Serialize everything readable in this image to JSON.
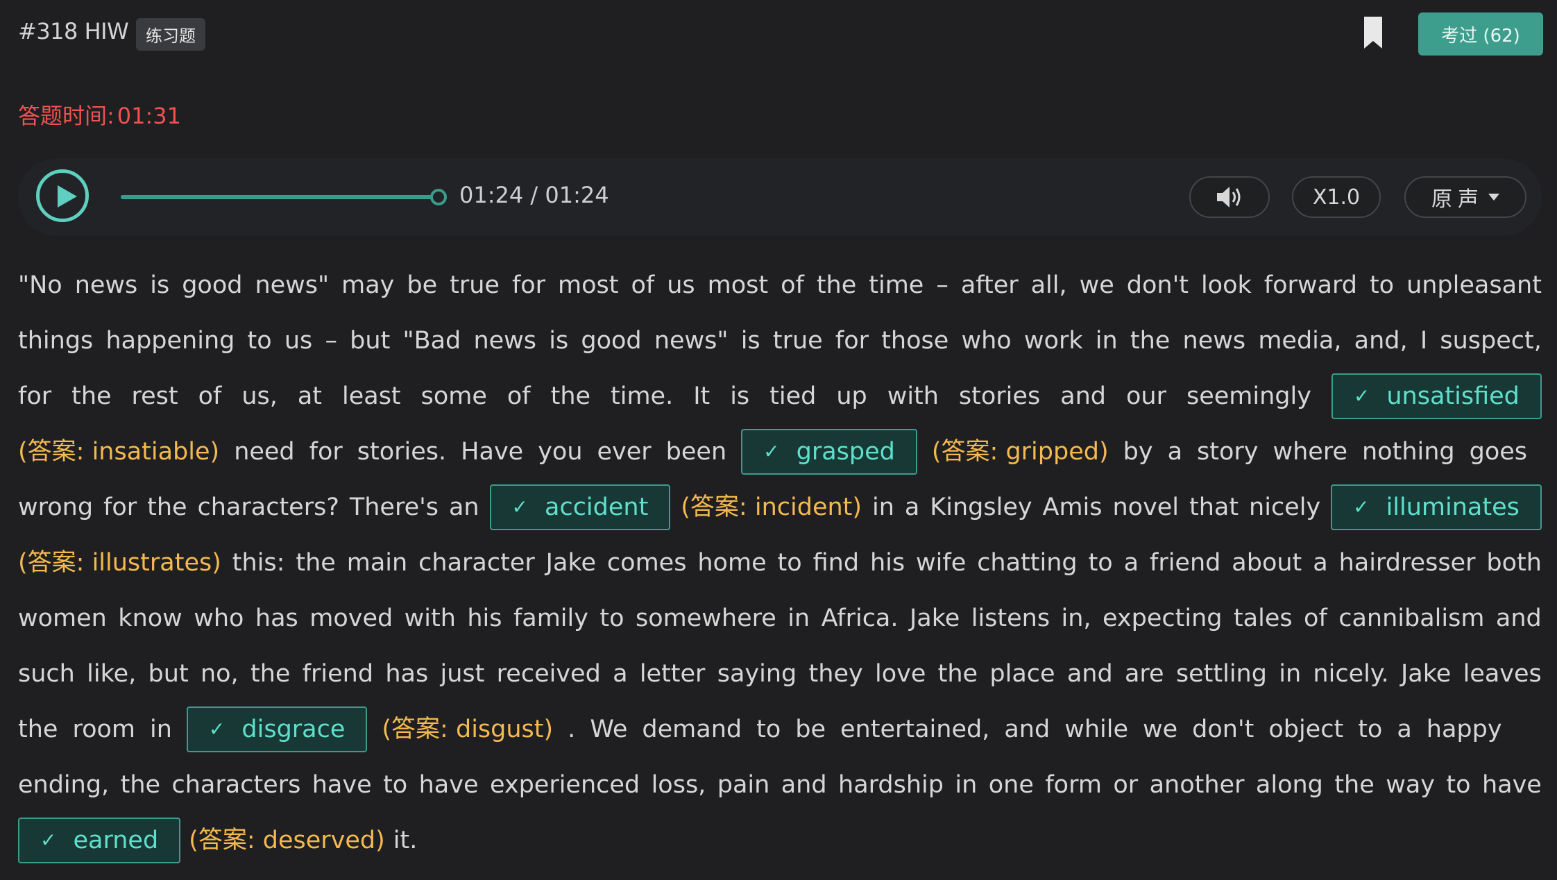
{
  "header": {
    "question_id": "#318 HIW",
    "tag": "练习题",
    "exam_button": "考过 (62)"
  },
  "timer": {
    "label": "答题时间:",
    "value": "01:31"
  },
  "player": {
    "time": "01:24 / 01:24",
    "progress": 1.0,
    "speed": "X1.0",
    "voice": "原声",
    "icons": [
      "play-icon",
      "volume-icon",
      "caret-down-icon"
    ]
  },
  "passage": {
    "line1": [
      "\"No",
      "news",
      "is",
      "good",
      "news\"",
      "may",
      "be",
      "true",
      "for",
      "most",
      "of",
      "us",
      "most",
      "of",
      "the",
      "time",
      "–",
      "after",
      "all,",
      "we",
      "don't",
      "look",
      "forward",
      "to",
      "unpleasant"
    ],
    "line2": [
      "things",
      "happening",
      "to",
      "us",
      "–",
      "but",
      "\"Bad",
      "news",
      "is",
      "good",
      "news\"",
      "is",
      "true",
      "for",
      "those",
      "who",
      "work",
      "in",
      "the",
      "news",
      "media,",
      "and,",
      "I",
      "suspect,"
    ],
    "line3": [
      "for",
      "the",
      "rest",
      "of",
      "us,",
      "at",
      "least",
      "some",
      "of",
      "the",
      "time.",
      "It",
      "is",
      "tied",
      "up",
      "with",
      "stories",
      "and",
      "our",
      "seemingly"
    ],
    "line4": [
      "need",
      "for",
      "stories.",
      "Have",
      "you",
      "ever",
      "been"
    ],
    "line4b": [
      "by",
      "a",
      "story",
      "where",
      "nothing",
      "goes"
    ],
    "line5": [
      "wrong",
      "for",
      "the",
      "characters?",
      "There's",
      "an"
    ],
    "line5b": [
      "in",
      "a",
      "Kingsley",
      "Amis",
      "novel",
      "that",
      "nicely"
    ],
    "line6": [
      "this:",
      "the",
      "main",
      "character",
      "Jake",
      "comes",
      "home",
      "to",
      "find",
      "his",
      "wife",
      "chatting",
      "to",
      "a",
      "friend",
      "about",
      "a",
      "hairdresser",
      "both"
    ],
    "line7": [
      "women",
      "know",
      "who",
      "has",
      "moved",
      "with",
      "his",
      "family",
      "to",
      "somewhere",
      "in",
      "Africa.",
      "Jake",
      "listens",
      "in,",
      "expecting",
      "tales",
      "of",
      "cannibalism",
      "and"
    ],
    "line8": [
      "such",
      "like,",
      "but",
      "no,",
      "the",
      "friend",
      "has",
      "just",
      "received",
      "a",
      "letter",
      "saying",
      "they",
      "love",
      "the",
      "place",
      "and",
      "are",
      "settling",
      "in",
      "nicely.",
      "Jake",
      "leaves"
    ],
    "line9": [
      "the",
      "room",
      "in"
    ],
    "line9b": [
      "We",
      "demand",
      "to",
      "be",
      "entertained,",
      "and",
      "while",
      "we",
      "don't",
      "object",
      "to",
      "a",
      "happy"
    ],
    "line10": [
      "ending,",
      "the",
      "characters",
      "have",
      "to",
      "have",
      "experienced",
      "loss,",
      "pain",
      "and",
      "hardship",
      "in",
      "one",
      "form",
      "or",
      "another",
      "along",
      "the",
      "way",
      "to",
      "have"
    ],
    "ending": "it."
  },
  "blanks": [
    {
      "entered": "unsatisfied",
      "answer": "(答案: insatiable)"
    },
    {
      "entered": "grasped",
      "answer": "(答案: gripped)"
    },
    {
      "entered": "accident",
      "answer": "(答案: incident)"
    },
    {
      "entered": "illuminates",
      "answer": "(答案: illustrates)"
    },
    {
      "entered": "disgrace",
      "answer": "(答案: disgust)"
    },
    {
      "entered": "earned",
      "answer": "(答案: deserved)"
    }
  ],
  "check_mark": "✓",
  "colors": {
    "background": "#1f1f21",
    "accent": "#3a9c8d",
    "timer": "#f0524f",
    "answer": "#f4b94f",
    "blank_text": "#5ee0cc"
  }
}
